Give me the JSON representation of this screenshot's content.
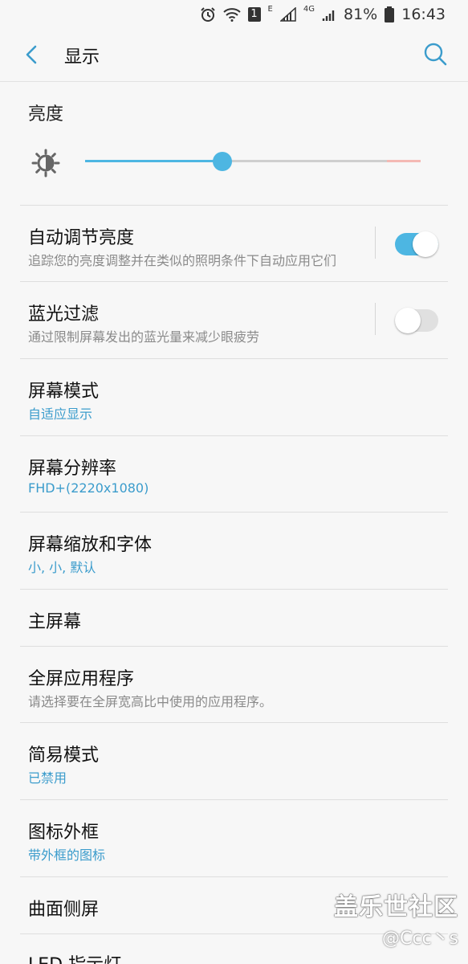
{
  "status_bar": {
    "battery": "81%",
    "time": "16:43",
    "sim_badge": "1",
    "net_e": "E",
    "net_4g": "4G"
  },
  "header": {
    "title": "显示"
  },
  "brightness": {
    "title": "亮度",
    "level": 0.41
  },
  "rows": [
    {
      "title": "自动调节亮度",
      "subtitle": "追踪您的亮度调整并在类似的照明条件下自动应用它们",
      "toggle_on": true
    },
    {
      "title": "蓝光过滤",
      "subtitle": "通过限制屏幕发出的蓝光量来减少眼疲劳",
      "toggle_on": false
    },
    {
      "title": "屏幕模式",
      "subtitle": "自适应显示"
    },
    {
      "title": "屏幕分辨率",
      "subtitle": "FHD+(2220x1080)"
    },
    {
      "title": "屏幕缩放和字体",
      "subtitle": "小, 小, 默认"
    },
    {
      "title": "主屏幕"
    },
    {
      "title": "全屏应用程序",
      "subtitle": "请选择要在全屏宽高比中使用的应用程序。"
    },
    {
      "title": "简易模式",
      "subtitle": "已禁用"
    },
    {
      "title": "图标外框",
      "subtitle": "带外框的图标"
    },
    {
      "title": "曲面侧屏"
    },
    {
      "title": "LED 指示灯"
    }
  ],
  "watermark": {
    "site": "盖乐世社区",
    "user": "@Ccc丶s"
  },
  "colors": {
    "accent": "#4db6e2",
    "link": "#3b9ccc",
    "toggle_off": "#e0e0e0"
  }
}
